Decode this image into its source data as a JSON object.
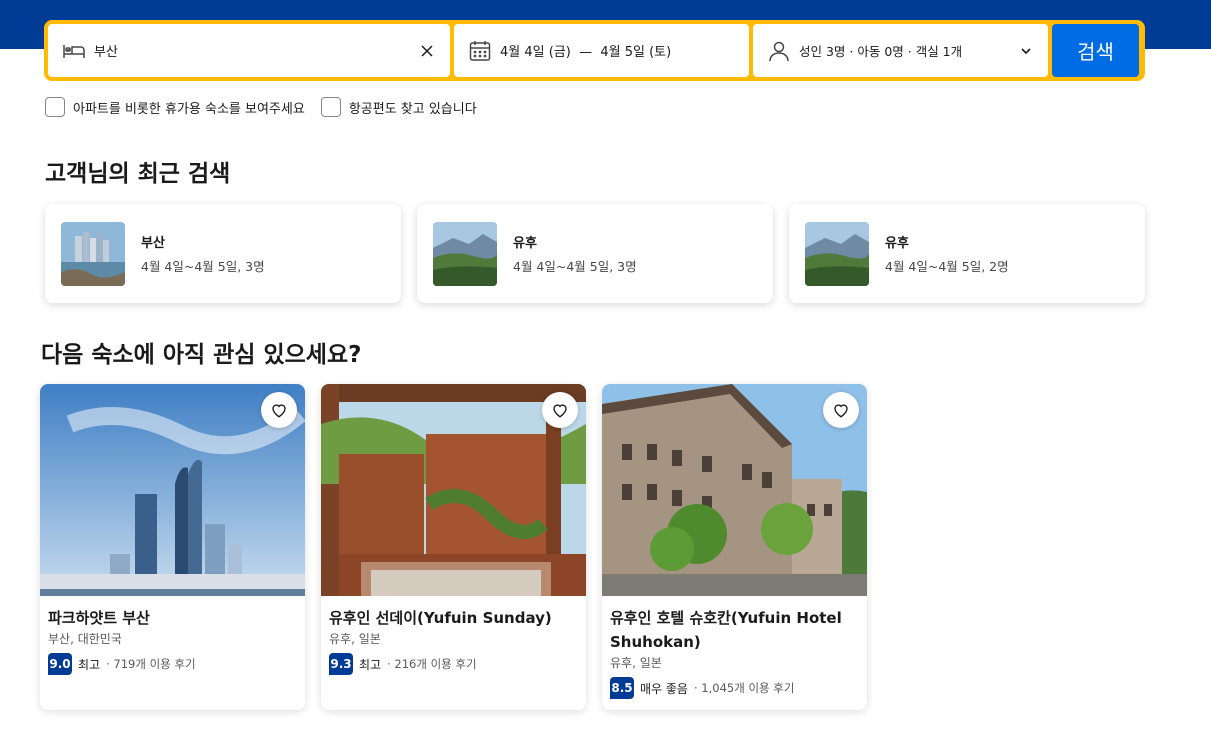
{
  "search": {
    "destination": "부산",
    "dates": "4월 4일 (금)  —  4월 5일 (토)",
    "guests": "성인 3명 · 아동 0명 · 객실 1개",
    "search_label": "검색"
  },
  "options": {
    "apartments_label": "아파트를 비롯한 휴가용 숙소를 보여주세요",
    "flights_label": "항공편도 찾고 있습니다"
  },
  "recent": {
    "heading": "고객님의 최근 검색",
    "items": [
      {
        "title": "부산",
        "sub": "4월 4일~4월 5일, 3명"
      },
      {
        "title": "유후",
        "sub": "4월 4일~4월 5일, 3명"
      },
      {
        "title": "유후",
        "sub": "4월 4일~4월 5일, 2명"
      }
    ]
  },
  "interest": {
    "heading": "다음 숙소에 아직 관심 있으세요?",
    "cards": [
      {
        "name": "파크하얏트 부산",
        "location": "부산, 대한민국",
        "score": "9.0",
        "word": "최고",
        "reviews": "· 719개 이용 후기"
      },
      {
        "name": "유후인 선데이(Yufuin Sunday)",
        "location": "유후, 일본",
        "score": "9.3",
        "word": "최고",
        "reviews": "· 216개 이용 후기"
      },
      {
        "name": "유후인 호텔 슈호칸(Yufuin Hotel Shuhokan)",
        "location": "유후, 일본",
        "score": "8.5",
        "word": "매우 좋음",
        "reviews": "· 1,045개 이용 후기"
      }
    ]
  },
  "colors": {
    "brand_blue": "#003b95",
    "accent_yellow": "#febb02",
    "button_blue": "#006ce4"
  },
  "icons": [
    "bed-icon",
    "close-icon",
    "calendar-icon",
    "person-icon",
    "chevron-down-icon",
    "heart-icon"
  ]
}
